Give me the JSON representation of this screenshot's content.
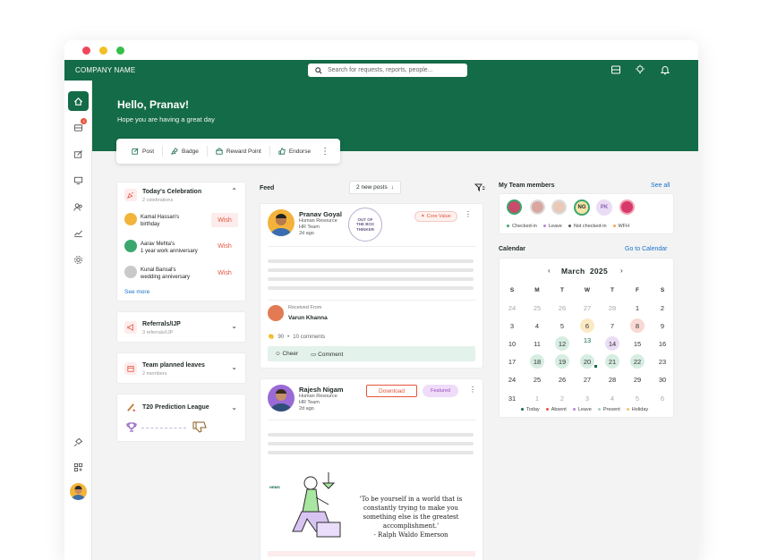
{
  "topbar": {
    "company": "COMPANY NAME",
    "search_placeholder": "Search for requests, reports, people..."
  },
  "hero": {
    "greeting": "Hello, Pranav!",
    "subtitle": "Hope you are having a great day"
  },
  "actions": [
    {
      "label": "Post",
      "icon": "post-icon"
    },
    {
      "label": "Badge",
      "icon": "badge-icon"
    },
    {
      "label": "Reward Point",
      "icon": "reward-icon"
    },
    {
      "label": "Endorse",
      "icon": "endorse-icon"
    }
  ],
  "sidebar": {
    "notification_count": "3"
  },
  "celebration": {
    "title": "Today's Celebration",
    "count": "2 celebrations",
    "see_more": "See more",
    "wish_label": "Wish",
    "items": [
      {
        "name": "Kamal Hassan's",
        "event": "birthday"
      },
      {
        "name": "Aarav Mehta's",
        "event": "1 year work anniversary"
      },
      {
        "name": "Kunal Bansal's",
        "event": "wedding anniversary"
      }
    ]
  },
  "referrals": {
    "title": "Referrals/IJP",
    "sub": "3 referrals/IJP"
  },
  "leaves": {
    "title": "Team planned leaves",
    "sub": "2 members"
  },
  "t20": {
    "title": "T20 Prediction League"
  },
  "feed": {
    "title": "Feed",
    "new_posts": "2 new posts",
    "post1": {
      "name": "Pranav Goyal",
      "dept": "Human Resource",
      "team": "HR Team",
      "time": "2d ago",
      "tag": "Core Value",
      "badge_text": "OUT OF THE BOX THINKER",
      "received_from": "Received From",
      "sender": "Varun Khanna",
      "reactions": "90",
      "comments": "10 comments",
      "cheer": "Cheer",
      "comment": "Comment"
    },
    "post2": {
      "name": "Rajesh Nigam",
      "dept": "Human Resource",
      "team": "HR Team",
      "time": "2d ago",
      "download": "Download",
      "featured": "Featured",
      "brand": "HRMS",
      "quote": "'To be yourself in a world that is constantly trying to make you something else is the greatest accomplishment.'",
      "author": "- Ralph Waldo Emerson"
    }
  },
  "team": {
    "title": "My Team members",
    "see_all": "See all",
    "initials": [
      "NG",
      "PK"
    ],
    "legend": [
      "Checked-in",
      "Leave",
      "Not checked-in",
      "WFH"
    ]
  },
  "calendar": {
    "title": "Calendar",
    "link": "Go to Calendar",
    "month": "March",
    "year": "2025",
    "weekdays": [
      "S",
      "M",
      "T",
      "W",
      "T",
      "F",
      "S"
    ],
    "legend": [
      "Today",
      "Absent",
      "Leave",
      "Present",
      "Holiday"
    ]
  },
  "colors": {
    "brand": "#146b47",
    "accent_red": "#e5543d",
    "present": "#d6ede2",
    "leave": "#eadcf5",
    "absent": "#f9d9d4",
    "holiday": "#fbe9c4"
  }
}
